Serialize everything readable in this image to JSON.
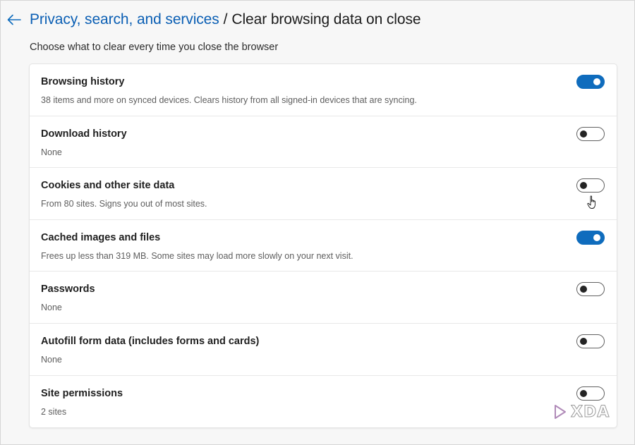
{
  "header": {
    "back_icon": "back-arrow-icon",
    "breadcrumb_parent": "Privacy, search, and services",
    "breadcrumb_separator": "/",
    "breadcrumb_current": "Clear browsing data on close"
  },
  "subtitle": "Choose what to clear every time you close the browser",
  "colors": {
    "accent": "#0f6cbd",
    "link": "#0b5fb4"
  },
  "options": [
    {
      "title": "Browsing history",
      "description": "38 items and more on synced devices. Clears history from all signed-in devices that are syncing.",
      "enabled": true
    },
    {
      "title": "Download history",
      "description": "None",
      "enabled": false
    },
    {
      "title": "Cookies and other site data",
      "description": "From 80 sites. Signs you out of most sites.",
      "enabled": false
    },
    {
      "title": "Cached images and files",
      "description": "Frees up less than 319 MB. Some sites may load more slowly on your next visit.",
      "enabled": true
    },
    {
      "title": "Passwords",
      "description": "None",
      "enabled": false
    },
    {
      "title": "Autofill form data (includes forms and cards)",
      "description": "None",
      "enabled": false
    },
    {
      "title": "Site permissions",
      "description": "2 sites",
      "enabled": false
    }
  ],
  "watermark": {
    "text": "XDA",
    "icon": "xda-logo-icon"
  },
  "cursor_icon": "hand-pointer-icon"
}
